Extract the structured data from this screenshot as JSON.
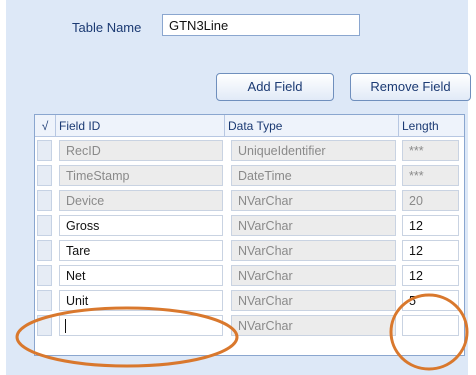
{
  "form": {
    "table_name_label": "Table Name",
    "table_name_value": "GTN3Line",
    "add_field_label": "Add Field",
    "remove_field_label": "Remove Field"
  },
  "grid": {
    "headers": {
      "check": "√",
      "field_id": "Field ID",
      "data_type": "Data Type",
      "length": "Length"
    },
    "rows": [
      {
        "field_id": "RecID",
        "data_type": "UniqueIdentifier",
        "length": "***",
        "editable": false
      },
      {
        "field_id": "TimeStamp",
        "data_type": "DateTime",
        "length": "***",
        "editable": false
      },
      {
        "field_id": "Device",
        "data_type": "NVarChar",
        "length": "20",
        "editable": false
      },
      {
        "field_id": "Gross",
        "data_type": "NVarChar",
        "length": "12",
        "editable": true
      },
      {
        "field_id": "Tare",
        "data_type": "NVarChar",
        "length": "12",
        "editable": true
      },
      {
        "field_id": "Net",
        "data_type": "NVarChar",
        "length": "12",
        "editable": true
      },
      {
        "field_id": "Unit",
        "data_type": "NVarChar",
        "length": "5",
        "editable": true
      },
      {
        "field_id": "",
        "data_type": "NVarChar",
        "length": "",
        "editable": true,
        "new_row": true
      }
    ]
  },
  "colors": {
    "panel_bg": "#dde8f7",
    "annotation": "#d9782d"
  }
}
